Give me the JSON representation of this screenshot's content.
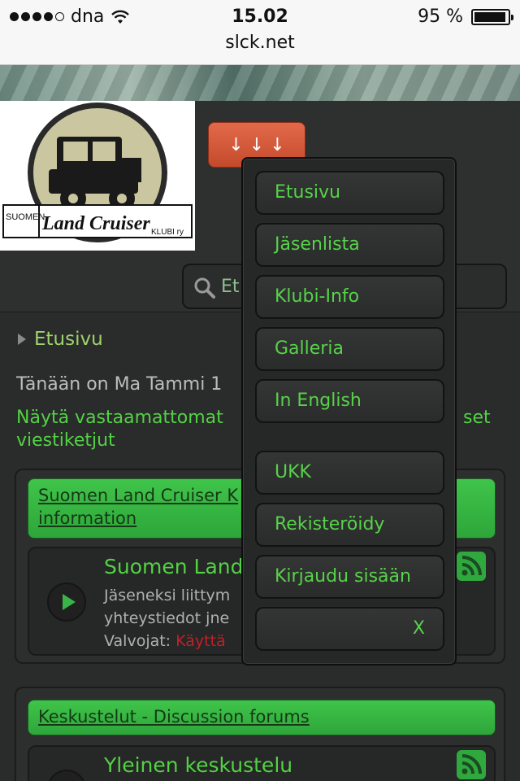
{
  "status_bar": {
    "carrier": "dna",
    "time": "15.02",
    "battery_percent": "95 %",
    "battery_level": 0.95,
    "url": "slck.net"
  },
  "header": {
    "menu_button_label": "↓ ↓ ↓",
    "logo_text_top": "SUOMEN",
    "logo_text_main": "Land Cruiser",
    "logo_text_bottom": "KLUBI ry",
    "search_placeholder": "Et"
  },
  "breadcrumb": {
    "label": "Etusivu"
  },
  "today_text": "Tänään on Ma Tammi 1",
  "links": {
    "left_line1": "Näytä vastaamattomat",
    "right_line1": "set",
    "line2": "viestiketjut"
  },
  "sections": [
    {
      "header": "Suomen Land Cruiser K",
      "header_line2": "information",
      "forums": [
        {
          "title": "Suomen Land",
          "desc_line1": "Jäseneksi liittym",
          "desc_line2": "yhteystiedot jne",
          "moderators_label": "Valvojat:",
          "moderators_value": "Käyttä"
        }
      ]
    },
    {
      "header": "Keskustelut - Discussion forums",
      "forums": [
        {
          "title": "Yleinen keskustelu"
        }
      ]
    }
  ],
  "dropdown_menu": {
    "items": [
      "Etusivu",
      "Jäsenlista",
      "Klubi-Info",
      "Galleria",
      "In English",
      "UKK",
      "Rekisteröidy",
      "Kirjaudu sisään"
    ],
    "close_label": "X"
  },
  "colors": {
    "link_green": "#53d244",
    "menu_button": "#d55a3b",
    "background": "#2a2b2b"
  }
}
